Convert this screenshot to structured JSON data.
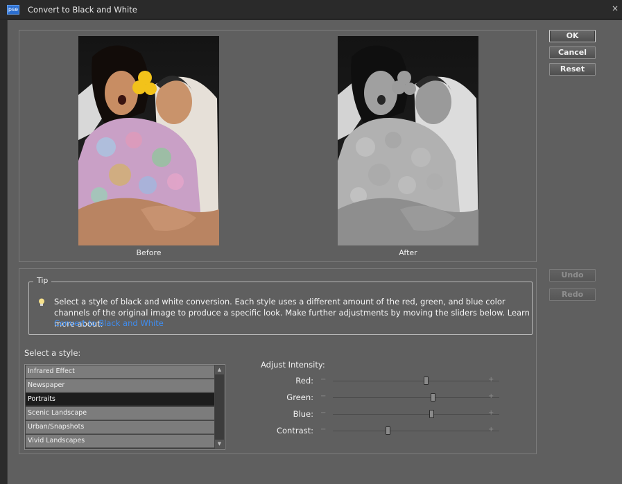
{
  "window": {
    "title": "Convert to Black and White",
    "app_icon": "pse",
    "close_glyph": "×"
  },
  "buttons": {
    "ok": "OK",
    "cancel": "Cancel",
    "reset": "Reset",
    "undo": "Undo",
    "redo": "Redo"
  },
  "preview": {
    "before_label": "Before",
    "after_label": "After"
  },
  "tip": {
    "legend": "Tip",
    "text": "Select a style of black and white conversion. Each style uses a different amount of the red, green, and blue color channels of the original image to produce a specific look. Make further adjustments by moving the sliders below. Learn more about:",
    "link": "Convert to Black and White"
  },
  "styles": {
    "label": "Select a style:",
    "items": [
      "Infrared Effect",
      "Newspaper",
      "Portraits",
      "Scenic Landscape",
      "Urban/Snapshots",
      "Vivid Landscapes"
    ],
    "selected": "Portraits"
  },
  "intensity": {
    "label": "Adjust Intensity:",
    "minus": "−",
    "plus": "+",
    "sliders": [
      {
        "name": "Red:",
        "value": 0.56
      },
      {
        "name": "Green:",
        "value": 0.6
      },
      {
        "name": "Blue:",
        "value": 0.59
      },
      {
        "name": "Contrast:",
        "value": 0.33
      }
    ]
  },
  "colors": {
    "accent_link": "#3f8df0",
    "flower": "#f2c21a"
  }
}
